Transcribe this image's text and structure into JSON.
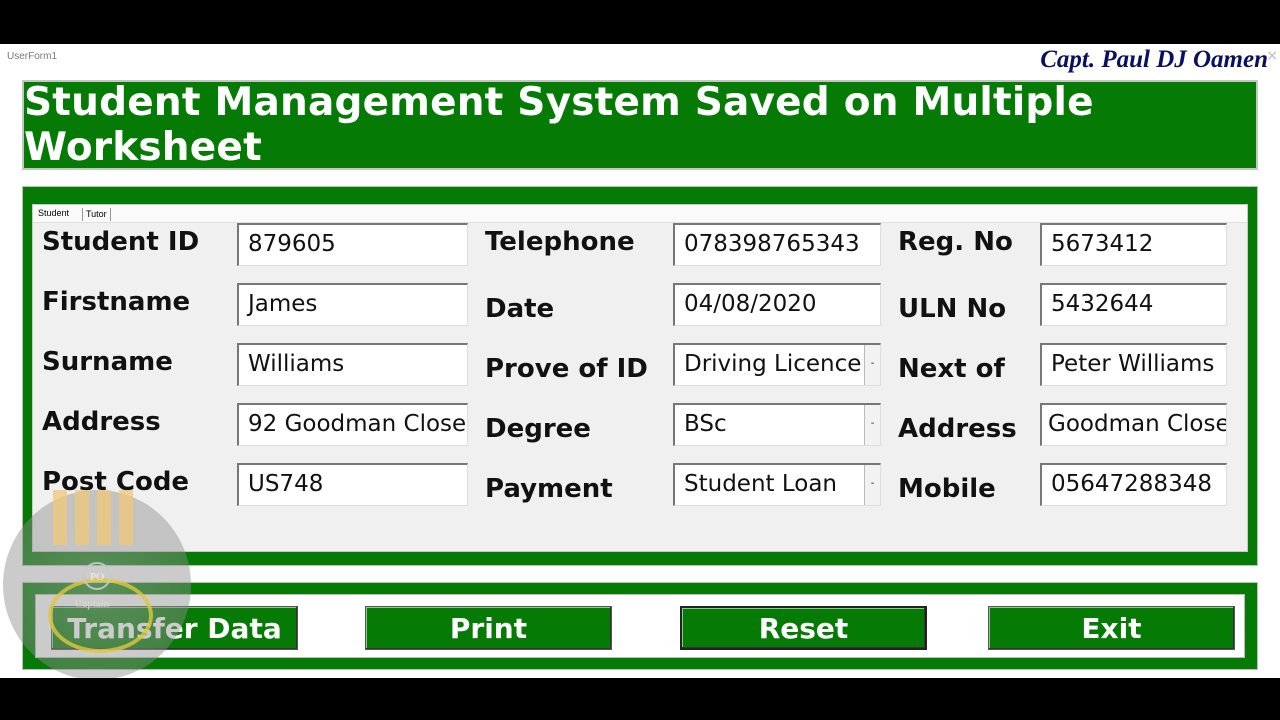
{
  "window": {
    "title": "UserForm1",
    "author": "Capt. Paul DJ Oamen",
    "close_glyph": "×"
  },
  "banner": {
    "title": "Student Management System Saved on Multiple Worksheet"
  },
  "tabs": [
    {
      "label": "Student",
      "active": true
    },
    {
      "label": "Tutor",
      "active": false
    }
  ],
  "columns": {
    "left": [
      {
        "label": "Student ID",
        "value": "879605"
      },
      {
        "label": "Firstname",
        "value": "James"
      },
      {
        "label": "Surname",
        "value": "Williams"
      },
      {
        "label": "Address",
        "value": "92 Goodman Close"
      },
      {
        "label": "Post Code",
        "value": "US748"
      }
    ],
    "middle": [
      {
        "label": "Telephone",
        "value": "078398765343",
        "type": "text"
      },
      {
        "label": "Date",
        "value": "04/08/2020",
        "type": "text"
      },
      {
        "label": "Prove of ID",
        "value": "Driving Licence",
        "type": "combo"
      },
      {
        "label": "Degree",
        "value": "BSc",
        "type": "combo"
      },
      {
        "label": "Payment",
        "value": "Student Loan",
        "type": "combo"
      }
    ],
    "right": [
      {
        "label": "Reg. No",
        "value": "5673412"
      },
      {
        "label": "ULN No",
        "value": "5432644"
      },
      {
        "label": "Next of",
        "value": "Peter Williams"
      },
      {
        "label": "Address",
        "value": "Goodman Close"
      },
      {
        "label": "Mobile",
        "value": "05647288348"
      }
    ]
  },
  "dropdown_glyph": "-",
  "buttons": {
    "transfer": "Transfer Data",
    "print": "Print",
    "reset": "Reset",
    "exit": "Exit"
  },
  "watermark": {
    "emblem": "PO",
    "caption": "Captain"
  },
  "colors": {
    "brand_green": "#057a05",
    "author_navy": "#0a1060"
  }
}
